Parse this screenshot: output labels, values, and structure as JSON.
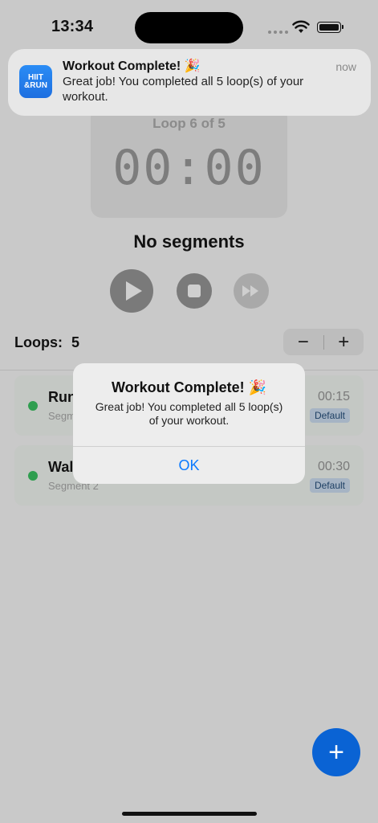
{
  "status_bar": {
    "time": "13:34"
  },
  "notification": {
    "app_icon_text": "HIIT\n&RUN",
    "title": "Workout Complete! 🎉",
    "time": "now",
    "body": "Great job! You completed all 5 loop(s) of your workout."
  },
  "timer": {
    "loop_label": "Loop 6 of 5",
    "display": "00:00"
  },
  "segment_title": "No segments",
  "loops": {
    "label": "Loops:",
    "value": "5",
    "minus": "−",
    "plus": "+"
  },
  "segments": [
    {
      "name": "Run",
      "subtitle": "Segment 1",
      "duration": "00:15",
      "badge": "Default"
    },
    {
      "name": "Walk",
      "subtitle": "Segment 2",
      "duration": "00:30",
      "badge": "Default"
    }
  ],
  "alert": {
    "title": "Workout Complete! 🎉",
    "message": "Great job! You completed all 5 loop(s) of your workout.",
    "ok_label": "OK"
  },
  "fab": {
    "label": "+"
  },
  "colors": {
    "accent": "#0a7aff",
    "fab": "#0a63d4",
    "active_dot": "#2f9e4f"
  }
}
